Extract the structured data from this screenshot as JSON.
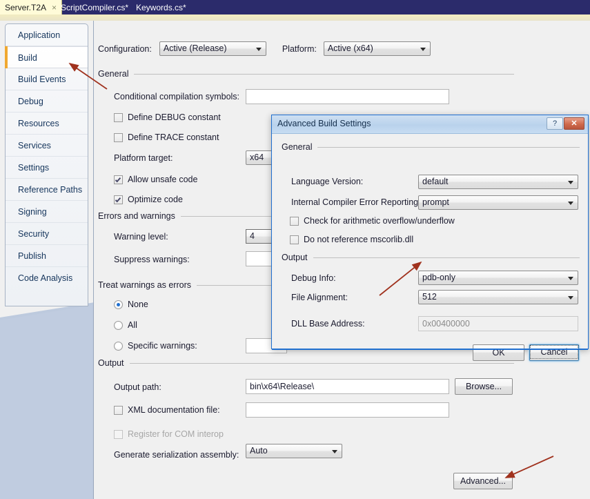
{
  "tabs": [
    {
      "label": "Server.T2A",
      "active": true,
      "close": "×"
    },
    {
      "label": "ScriptCompiler.cs*",
      "active": false
    },
    {
      "label": "Keywords.cs*",
      "active": false
    }
  ],
  "sidebar": {
    "items": [
      {
        "label": "Application"
      },
      {
        "label": "Build"
      },
      {
        "label": "Build Events"
      },
      {
        "label": "Debug"
      },
      {
        "label": "Resources"
      },
      {
        "label": "Services"
      },
      {
        "label": "Settings"
      },
      {
        "label": "Reference Paths"
      },
      {
        "label": "Signing"
      },
      {
        "label": "Security"
      },
      {
        "label": "Publish"
      },
      {
        "label": "Code Analysis"
      }
    ],
    "selected": "Build"
  },
  "toolbar": {
    "configuration_label": "Configuration:",
    "configuration_value": "Active (Release)",
    "platform_label": "Platform:",
    "platform_value": "Active (x64)"
  },
  "general": {
    "title": "General",
    "conditional_label": "Conditional compilation symbols:",
    "conditional_value": "",
    "define_debug": "Define DEBUG constant",
    "define_trace": "Define TRACE constant",
    "platform_target_label": "Platform target:",
    "platform_target_value": "x64",
    "allow_unsafe": "Allow unsafe code",
    "optimize_code": "Optimize code"
  },
  "errors": {
    "title": "Errors and warnings",
    "warning_level_label": "Warning level:",
    "warning_level_value": "4",
    "suppress_label": "Suppress warnings:",
    "suppress_value": ""
  },
  "treat": {
    "title": "Treat warnings as errors",
    "none": "None",
    "all": "All",
    "specific": "Specific warnings:",
    "specific_value": ""
  },
  "output": {
    "title": "Output",
    "output_path_label": "Output path:",
    "output_path_value": "bin\\x64\\Release\\",
    "browse_label": "Browse...",
    "xml_doc_label": "XML documentation file:",
    "xml_doc_value": "",
    "com_interop_label": "Register for COM interop",
    "serialization_label": "Generate serialization assembly:",
    "serialization_value": "Auto",
    "advanced_label": "Advanced..."
  },
  "dialog": {
    "title": "Advanced Build Settings",
    "help_glyph": "?",
    "close_glyph": "✕",
    "general_title": "General",
    "language_version_label": "Language Version:",
    "language_version_value": "default",
    "ice_label": "Internal Compiler Error Reporting:",
    "ice_value": "prompt",
    "arith_label": "Check for arithmetic overflow/underflow",
    "mscorlib_label": "Do not reference mscorlib.dll",
    "output_title": "Output",
    "debug_info_label": "Debug Info:",
    "debug_info_value": "pdb-only",
    "file_alignment_label": "File Alignment:",
    "file_alignment_value": "512",
    "dll_base_label": "DLL Base Address:",
    "dll_base_value": "0x00400000",
    "ok_label": "OK",
    "cancel_label": "Cancel"
  },
  "colors": {
    "accent_orange": "#f0a830",
    "annotation_red": "#a0321e",
    "dialog_border_blue": "#1f6fd0",
    "tab_active_bg": "#fffbd8",
    "tabstrip_bg": "#2b2b6b"
  }
}
